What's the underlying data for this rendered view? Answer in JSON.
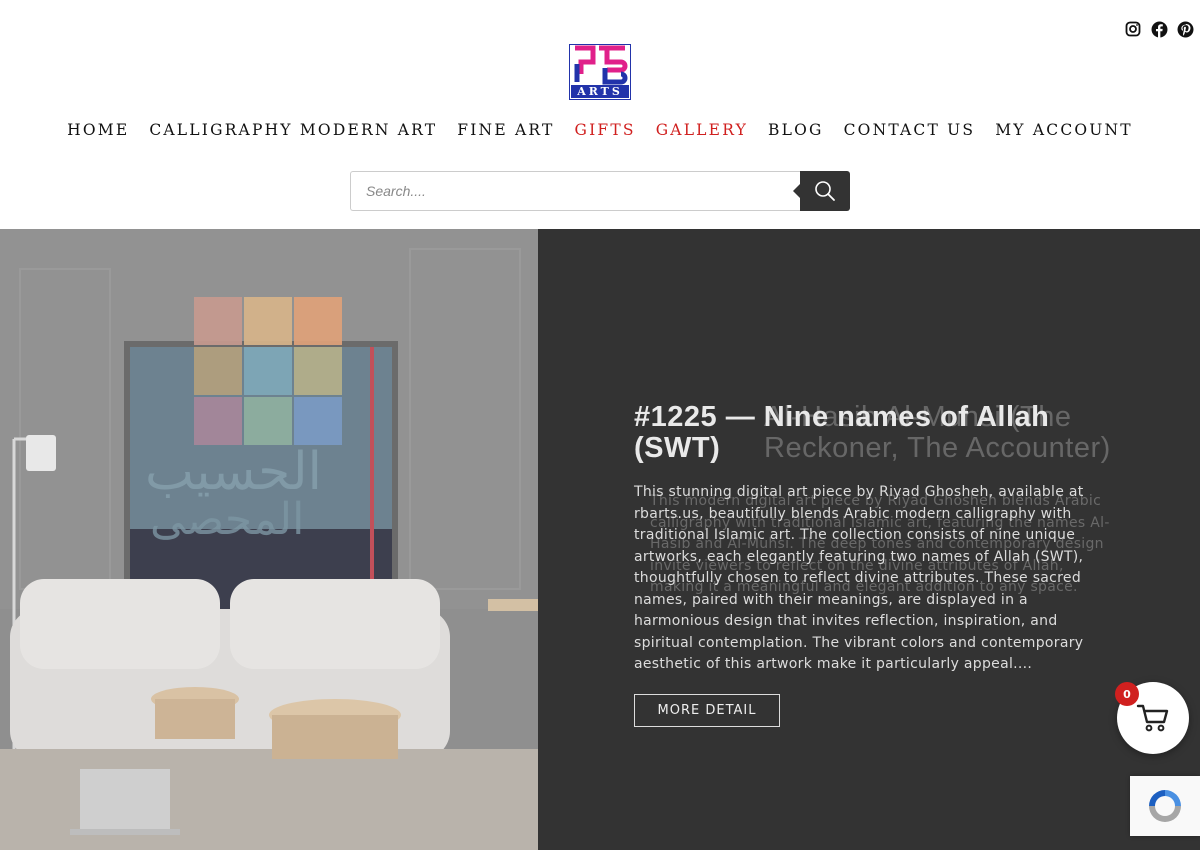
{
  "social": {
    "icons": [
      "instagram-icon",
      "facebook-icon",
      "pinterest-icon"
    ]
  },
  "logo": {
    "text": "ARTS",
    "colors": {
      "pink": "#e0208a",
      "blue": "#2233aa",
      "purple": "#6a2fb0"
    }
  },
  "nav": {
    "items": [
      {
        "label": "HOME",
        "highlight": false
      },
      {
        "label": "CALLIGRAPHY MODERN ART",
        "highlight": false
      },
      {
        "label": "FINE ART",
        "highlight": false
      },
      {
        "label": "GIFTS",
        "highlight": true
      },
      {
        "label": "GALLERY",
        "highlight": true
      },
      {
        "label": "BLOG",
        "highlight": false
      },
      {
        "label": "CONTACT US",
        "highlight": false
      },
      {
        "label": "MY ACCOUNT",
        "highlight": false
      }
    ],
    "highlight_color": "#d0201f"
  },
  "search": {
    "placeholder": "Search...."
  },
  "slider": {
    "title": "#1225 — Nine names of Allah (SWT)",
    "ghost_title": "Al-Hasib Al-Muhsi (The Reckoner, The Accounter)",
    "description": "This stunning digital art piece by Riyad Ghosheh, available at rbarts.us, beautifully blends Arabic modern calligraphy with traditional Islamic art. The collection consists of nine unique artworks, each elegantly featuring two names of Allah (SWT), thoughtfully chosen to reflect divine attributes. These sacred names, paired with their meanings, are displayed in a harmonious design that invites reflection, inspiration, and spiritual contemplation. The vibrant colors and contemporary aesthetic of this artwork make it particularly appeal....",
    "ghost_description": "This modern digital art piece by Riyad Ghosheh blends Arabic calligraphy with traditional Islamic art, featuring the names Al-Hasib and Al-Muhsi. The deep tones and contemporary design invite viewers to reflect on the divine attributes of Allah, making it a meaningful and elegant addition to any space.",
    "button_label": "MORE DETAIL",
    "panel_color": "#333333"
  },
  "cart": {
    "count": "0"
  }
}
